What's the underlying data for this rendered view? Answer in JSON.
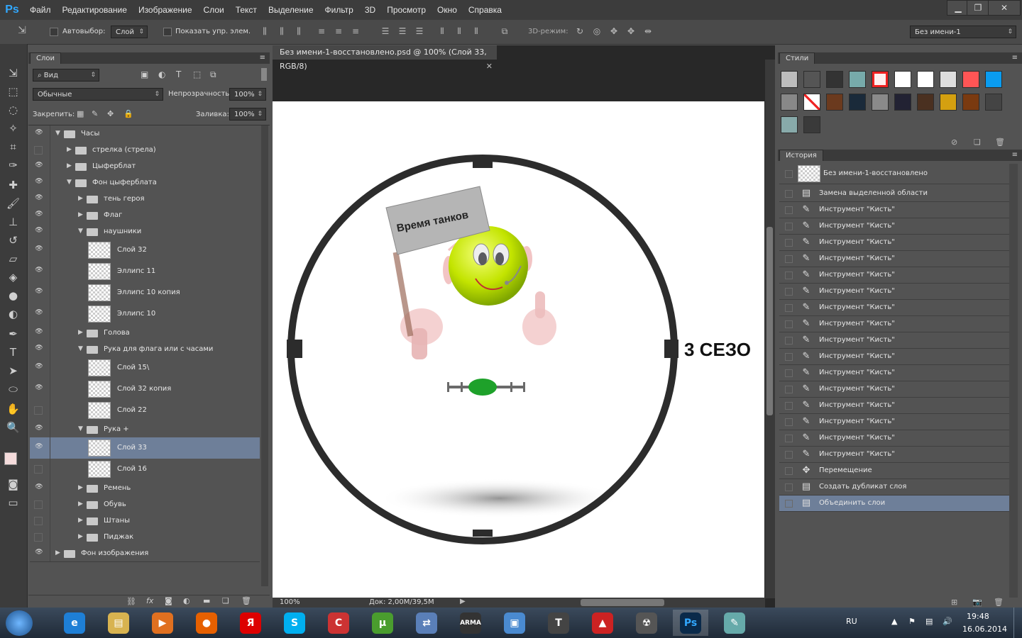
{
  "app": {
    "logo": "Ps"
  },
  "menu": [
    "Файл",
    "Редактирование",
    "Изображение",
    "Слои",
    "Текст",
    "Выделение",
    "Фильтр",
    "3D",
    "Просмотр",
    "Окно",
    "Справка"
  ],
  "options": {
    "autoselect_label": "Автовыбор:",
    "autoselect_value": "Слой",
    "show_controls_label": "Показать упр. элем.",
    "mode3d_label": "3D-режим:",
    "workspace_value": "Без имени-1"
  },
  "document": {
    "tab_title": "Без имени-1-восстановлено.psd @ 100% (Слой 33, RGB/8)",
    "zoom": "100%",
    "doc_size": "Док: 2,00M/39,5M",
    "flag_text": "Время  танков",
    "side_text": "3 СЕЗО"
  },
  "layers_panel": {
    "tab": "Слои",
    "filter_label": "Вид",
    "blend_mode": "Обычные",
    "opacity_label": "Непрозрачность:",
    "opacity_value": "100%",
    "lock_label": "Закрепить:",
    "fill_label": "Заливка:",
    "fill_value": "100%",
    "layers": [
      {
        "name": "Часы",
        "type": "group",
        "open": true,
        "indent": 0,
        "visible": true
      },
      {
        "name": "стрелка (стрела)",
        "type": "group",
        "open": false,
        "indent": 1,
        "visible": false
      },
      {
        "name": "Цыферблат",
        "type": "group",
        "open": false,
        "indent": 1,
        "visible": true
      },
      {
        "name": "Фон цыферблата",
        "type": "group",
        "open": true,
        "indent": 1,
        "visible": true
      },
      {
        "name": "тень героя",
        "type": "group",
        "open": false,
        "indent": 2,
        "visible": true
      },
      {
        "name": "Флаг",
        "type": "group",
        "open": false,
        "indent": 2,
        "visible": true
      },
      {
        "name": "наушники",
        "type": "group",
        "open": true,
        "indent": 2,
        "visible": true
      },
      {
        "name": "Слой 32",
        "type": "layer",
        "indent": 3,
        "visible": true
      },
      {
        "name": "Эллипс 11",
        "type": "layer",
        "indent": 3,
        "visible": true
      },
      {
        "name": "Эллипс 10 копия",
        "type": "layer",
        "indent": 3,
        "visible": true
      },
      {
        "name": "Эллипс 10",
        "type": "layer",
        "indent": 3,
        "visible": true
      },
      {
        "name": "Голова",
        "type": "group",
        "open": false,
        "indent": 2,
        "visible": true
      },
      {
        "name": "Рука для флага или с часами",
        "type": "group",
        "open": true,
        "indent": 2,
        "visible": true
      },
      {
        "name": "Слой 15\\",
        "type": "layer",
        "indent": 3,
        "visible": true
      },
      {
        "name": "Слой 32 копия",
        "type": "layer",
        "indent": 3,
        "visible": true
      },
      {
        "name": "Слой 22",
        "type": "layer",
        "indent": 3,
        "visible": false
      },
      {
        "name": "Рука +",
        "type": "group",
        "open": true,
        "indent": 2,
        "visible": true
      },
      {
        "name": "Слой 33",
        "type": "layer",
        "indent": 3,
        "visible": true,
        "selected": true
      },
      {
        "name": "Слой 16",
        "type": "layer",
        "indent": 3,
        "visible": false
      },
      {
        "name": "Ремень",
        "type": "group",
        "open": false,
        "indent": 2,
        "visible": true
      },
      {
        "name": "Обувь",
        "type": "group",
        "open": false,
        "indent": 2,
        "visible": false
      },
      {
        "name": "Штаны",
        "type": "group",
        "open": false,
        "indent": 2,
        "visible": false
      },
      {
        "name": "Пиджак",
        "type": "group",
        "open": false,
        "indent": 2,
        "visible": false
      },
      {
        "name": "Фон изображения",
        "type": "group",
        "open": false,
        "indent": 0,
        "visible": true
      }
    ]
  },
  "styles_panel": {
    "tab": "Стили"
  },
  "history_panel": {
    "tab": "История",
    "snapshot": "Без имени-1-восстановлено",
    "items": [
      {
        "name": "Замена выделенной области",
        "icon": "doc"
      },
      {
        "name": "Инструмент \"Кисть\"",
        "icon": "brush"
      },
      {
        "name": "Инструмент \"Кисть\"",
        "icon": "brush"
      },
      {
        "name": "Инструмент \"Кисть\"",
        "icon": "brush"
      },
      {
        "name": "Инструмент \"Кисть\"",
        "icon": "brush"
      },
      {
        "name": "Инструмент \"Кисть\"",
        "icon": "brush"
      },
      {
        "name": "Инструмент \"Кисть\"",
        "icon": "brush"
      },
      {
        "name": "Инструмент \"Кисть\"",
        "icon": "brush"
      },
      {
        "name": "Инструмент \"Кисть\"",
        "icon": "brush"
      },
      {
        "name": "Инструмент \"Кисть\"",
        "icon": "brush"
      },
      {
        "name": "Инструмент \"Кисть\"",
        "icon": "brush"
      },
      {
        "name": "Инструмент \"Кисть\"",
        "icon": "brush"
      },
      {
        "name": "Инструмент \"Кисть\"",
        "icon": "brush"
      },
      {
        "name": "Инструмент \"Кисть\"",
        "icon": "brush"
      },
      {
        "name": "Инструмент \"Кисть\"",
        "icon": "brush"
      },
      {
        "name": "Инструмент \"Кисть\"",
        "icon": "brush"
      },
      {
        "name": "Инструмент \"Кисть\"",
        "icon": "brush"
      },
      {
        "name": "Перемещение",
        "icon": "move"
      },
      {
        "name": "Создать дубликат слоя",
        "icon": "doc"
      },
      {
        "name": "Объединить слои",
        "icon": "doc",
        "current": true
      }
    ]
  },
  "taskbar": {
    "lang": "RU",
    "time": "19:48",
    "date": "16.06.2014",
    "apps": [
      {
        "name": "ie-icon",
        "label": "e",
        "color": "#1e7fd6"
      },
      {
        "name": "explorer-icon",
        "label": "▤",
        "color": "#d8b350"
      },
      {
        "name": "media-player-icon",
        "label": "▶",
        "color": "#e07020"
      },
      {
        "name": "firefox-icon",
        "label": "●",
        "color": "#e66000"
      },
      {
        "name": "yandex-icon",
        "label": "Я",
        "color": "#d00"
      },
      {
        "name": "skype-icon",
        "label": "S",
        "color": "#00aff0"
      },
      {
        "name": "ccleaner-icon",
        "label": "C",
        "color": "#c33"
      },
      {
        "name": "utorrent-icon",
        "label": "µ",
        "color": "#4a9d2e"
      },
      {
        "name": "network-icon",
        "label": "⇄",
        "color": "#5a7fb8"
      },
      {
        "name": "arma-icon",
        "label": "ARMA",
        "color": "#333"
      },
      {
        "name": "control-panel-icon",
        "label": "▣",
        "color": "#4a8ad0"
      },
      {
        "name": "wot-icon",
        "label": "T",
        "color": "#444"
      },
      {
        "name": "game-center-icon",
        "label": "▲",
        "color": "#c22"
      },
      {
        "name": "stalker-icon",
        "label": "☢",
        "color": "#555"
      },
      {
        "name": "photoshop-icon",
        "label": "Ps",
        "color": "#0a2a4a"
      },
      {
        "name": "paint-icon",
        "label": "✎",
        "color": "#6aa"
      }
    ]
  }
}
